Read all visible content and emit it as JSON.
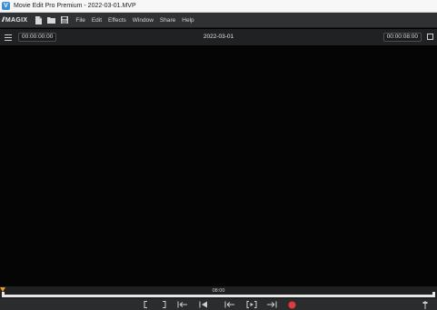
{
  "window": {
    "title": "Movie Edit Pro Premium - 2022-03-01.MVP",
    "app_icon": "magix-app-icon"
  },
  "menubar": {
    "logo_mark": "//",
    "logo_text": "MAGIX",
    "tool_icons": [
      "new-file-icon",
      "open-folder-icon",
      "save-icon"
    ],
    "items": [
      "File",
      "Edit",
      "Effects",
      "Window",
      "Share",
      "Help"
    ]
  },
  "preview": {
    "timecode_left": "00:00:00:00",
    "project_name": "2022-03-01",
    "timecode_right": "00:00:08:00",
    "background": "#050505"
  },
  "timeline": {
    "marker_label": "08:00",
    "position_fraction": 0.0,
    "playhead_color": "#f29a1a"
  },
  "transport": {
    "buttons": [
      "mark-in-icon",
      "mark-out-icon",
      "jump-to-in-icon",
      "jump-to-start-icon",
      "previous-marker-icon",
      "play-range-icon",
      "next-marker-icon",
      "record-icon",
      "mixer-icon"
    ],
    "record_color": "#e03a3a"
  }
}
